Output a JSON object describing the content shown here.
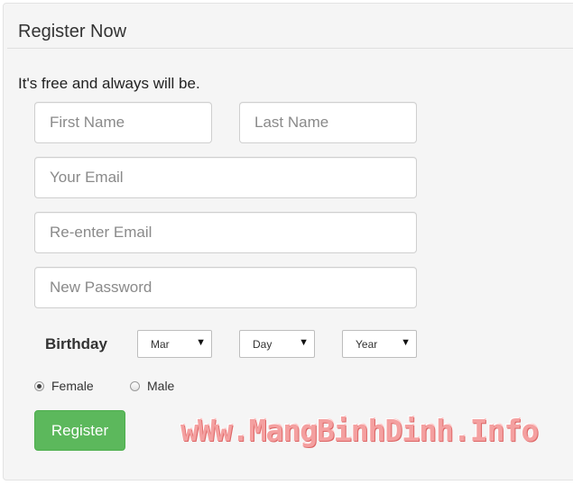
{
  "panel": {
    "title": "Register Now",
    "tagline": "It's free and always will be."
  },
  "form": {
    "first_name_placeholder": "First Name",
    "last_name_placeholder": "Last Name",
    "email_placeholder": "Your Email",
    "reenter_email_placeholder": "Re-enter Email",
    "password_placeholder": "New Password",
    "birthday_label": "Birthday",
    "month_value": "Mar",
    "day_value": "Day",
    "year_value": "Year",
    "gender_options": [
      "Female",
      "Male"
    ],
    "selected_gender": "Female",
    "register_label": "Register"
  },
  "watermark": "wWw.MangBinhDinh.Info",
  "colors": {
    "register_button": "#5cb85c",
    "panel_background": "#f5f5f5",
    "watermark": "#f4a0a0"
  },
  "icons": {
    "select_caret": "caret-down-icon"
  }
}
